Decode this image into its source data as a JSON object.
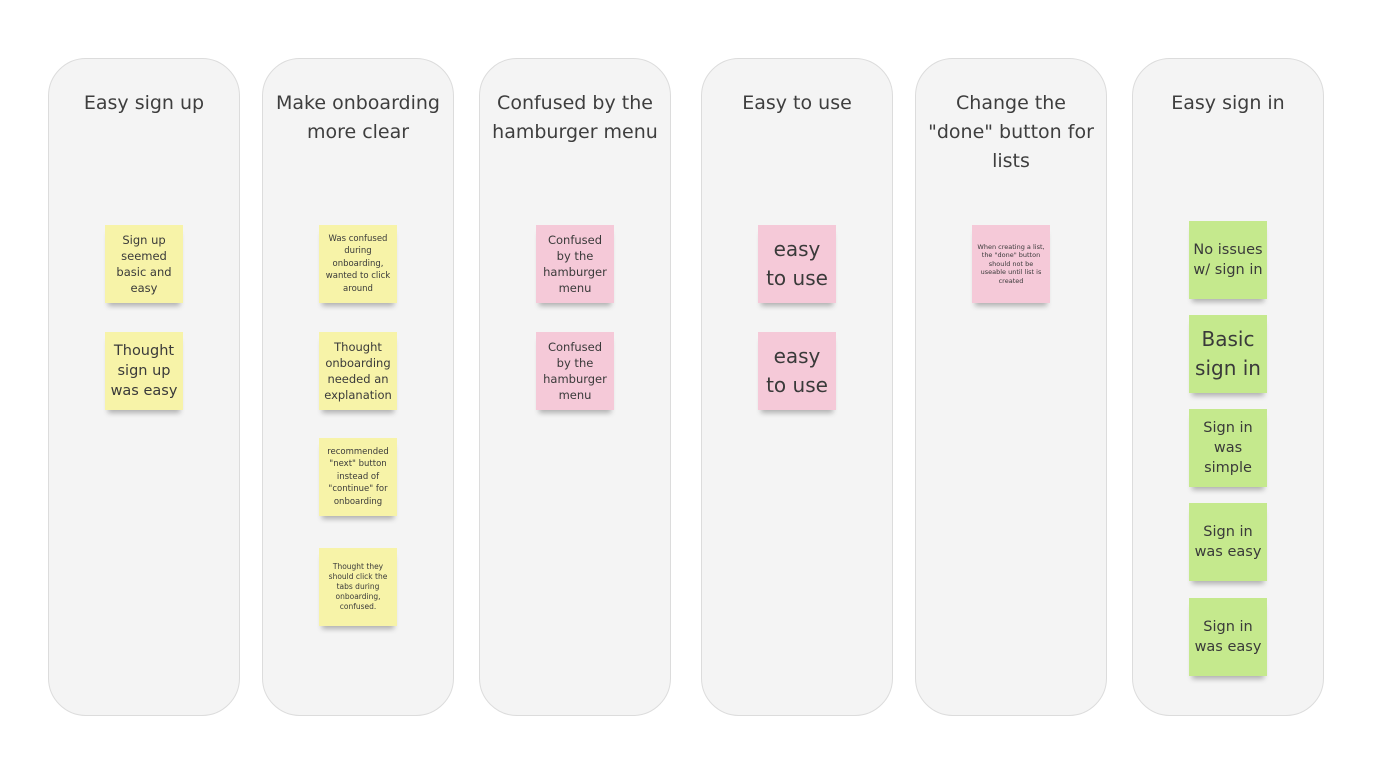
{
  "columns": [
    {
      "title": "Easy sign up",
      "stickies": [
        {
          "text": "Sign up seemed basic and easy"
        },
        {
          "text": "Thought sign up was easy"
        }
      ]
    },
    {
      "title": "Make onboarding more clear",
      "stickies": [
        {
          "text": "Was confused during onboarding, wanted to click around"
        },
        {
          "text": "Thought onboarding needed an explanation"
        },
        {
          "text": "recommended \"next\" button instead of \"continue\" for onboarding"
        },
        {
          "text": "Thought they should click the tabs during onboarding, confused."
        }
      ]
    },
    {
      "title": "Confused by the hamburger menu",
      "stickies": [
        {
          "text": "Confused by the hamburger menu"
        },
        {
          "text": "Confused by the hamburger menu"
        }
      ]
    },
    {
      "title": "Easy to use",
      "stickies": [
        {
          "text": "easy to use"
        },
        {
          "text": "easy to use"
        }
      ]
    },
    {
      "title": "Change the \"done\" button for lists",
      "stickies": [
        {
          "text": "When creating a list, the \"done\" button should not be useable until list is created"
        }
      ]
    },
    {
      "title": "Easy sign in",
      "stickies": [
        {
          "text": "No issues w/ sign in"
        },
        {
          "text": "Basic sign in"
        },
        {
          "text": "Sign in was simple"
        },
        {
          "text": "Sign in was easy"
        },
        {
          "text": "Sign in was easy"
        }
      ]
    }
  ],
  "colors": {
    "column_bg": "#f4f4f4",
    "sticky_yellow": "#f7f3a8",
    "sticky_pink": "#f5c9d8",
    "sticky_green": "#c5e98d"
  }
}
